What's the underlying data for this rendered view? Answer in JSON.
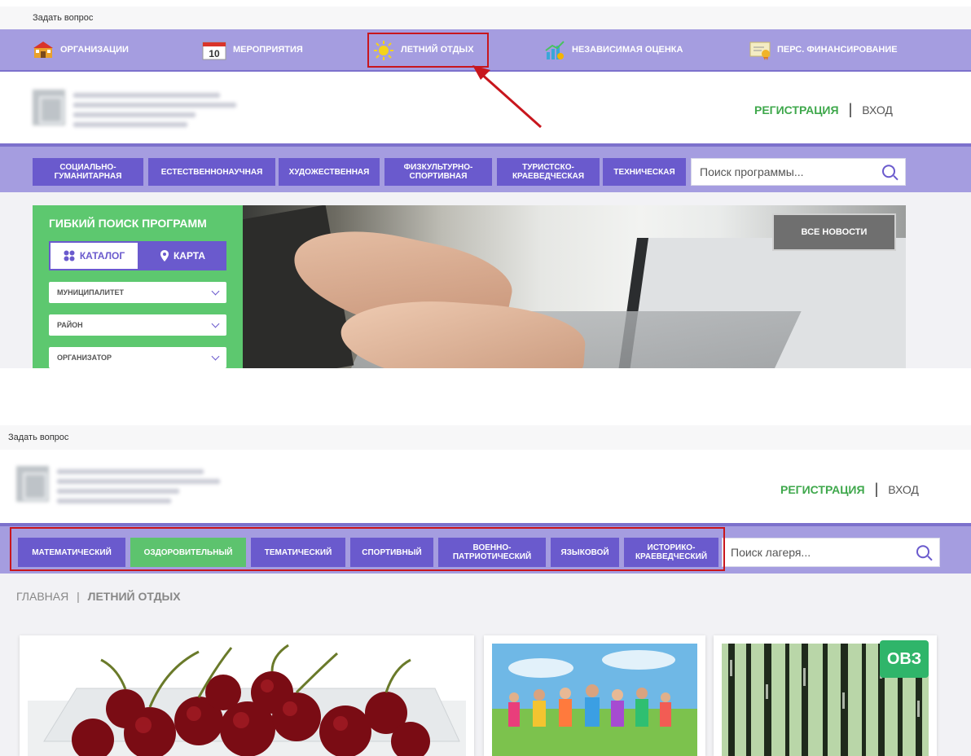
{
  "top": {
    "ask_question": "Задать вопрос",
    "nav": [
      {
        "label": "Организации",
        "icon": "organization-building-icon"
      },
      {
        "label": "Мероприятия",
        "icon": "calendar-icon",
        "calendar_day": "10"
      },
      {
        "label": "Летний отдых",
        "icon": "sun-icon"
      },
      {
        "label": "Независимая оценка",
        "icon": "chart-growth-icon"
      },
      {
        "label": "Перс. финансирование",
        "icon": "certificate-icon"
      }
    ],
    "auth": {
      "register": "Регистрация",
      "separator": "|",
      "login": "Вход"
    },
    "categories": [
      "Социально-\nгуманитарная",
      "Естественнонаучная",
      "Художественная",
      "Физкультурно-\nспортивная",
      "Туристско-\nкраеведческая",
      "Техническая"
    ],
    "search_placeholder": "Поиск программы...",
    "filter": {
      "title": "Гибкий поиск программ",
      "catalog": "Каталог",
      "map": "Карта",
      "selects": [
        "Муниципалитет",
        "Район",
        "Организатор"
      ]
    },
    "news_button": "Все новости"
  },
  "bottom": {
    "ask_question": "Задать вопрос",
    "auth": {
      "register": "Регистрация",
      "separator": "|",
      "login": "Вход"
    },
    "categories": [
      "Математический",
      "Оздоровительный",
      "Тематический",
      "Спортивный",
      "Военно-\nпатриотический",
      "Языковой",
      "Историко-\nкраеведческий"
    ],
    "search_placeholder": "Поиск лагеря...",
    "breadcrumb": {
      "home": "Главная",
      "separator": "|",
      "current": "Летний отдых"
    },
    "badge": "ОВЗ"
  },
  "colors": {
    "accent": "#6a5acd",
    "nav_bg": "#a59de0",
    "green": "#5dc86f",
    "highlight": "#c8161d"
  }
}
